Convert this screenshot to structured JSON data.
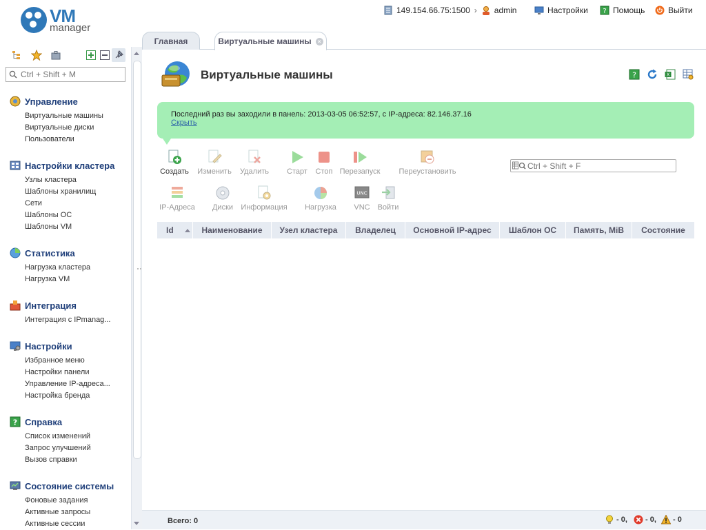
{
  "app": {
    "logo_main": "VM",
    "logo_sub": "manager"
  },
  "topbar": {
    "server": "149.154.66.75:1500",
    "user": "admin",
    "settings": "Настройки",
    "help": "Помощь",
    "logout": "Выйти"
  },
  "sidebar": {
    "search_placeholder": "Ctrl + Shift + M",
    "groups": [
      {
        "title": "Управление",
        "items": [
          "Виртуальные машины",
          "Виртуальные диски",
          "Пользователи"
        ]
      },
      {
        "title": "Настройки кластера",
        "items": [
          "Узлы кластера",
          "Шаблоны хранилищ",
          "Сети",
          "Шаблоны ОС",
          "Шаблоны VM"
        ]
      },
      {
        "title": "Статистика",
        "items": [
          "Нагрузка кластера",
          "Нагрузка VM"
        ]
      },
      {
        "title": "Интеграция",
        "items": [
          "Интеграция с IPmanag..."
        ]
      },
      {
        "title": "Настройки",
        "items": [
          "Избранное меню",
          "Настройки панели",
          "Управление IP-адреса...",
          "Настройка бренда"
        ]
      },
      {
        "title": "Справка",
        "items": [
          "Список изменений",
          "Запрос улучшений",
          "Вызов справки"
        ]
      },
      {
        "title": "Состояние системы",
        "items": [
          "Фоновые задания",
          "Активные запросы",
          "Активные сессии"
        ]
      }
    ]
  },
  "tabs": [
    {
      "label": "Главная"
    },
    {
      "label": "Виртуальные машины"
    }
  ],
  "page": {
    "title": "Виртуальные машины"
  },
  "notice": {
    "text": "Последний раз вы заходили в панель: 2013-03-05 06:52:57, с IP-адреса: 82.146.37.16",
    "hide": "Скрыть"
  },
  "toolbar": {
    "create": "Создать",
    "edit": "Изменить",
    "delete": "Удалить",
    "start": "Старт",
    "stop": "Стоп",
    "restart": "Перезапуск",
    "reinstall": "Переустановить",
    "ip": "IP-Адреса",
    "disks": "Диски",
    "info": "Информация",
    "load": "Нагрузка",
    "vnc": "VNC",
    "login": "Войти",
    "vnc_badge": "UNC"
  },
  "table": {
    "search_placeholder": "Ctrl + Shift + F",
    "columns": [
      "Id",
      "Наименование",
      "Узел кластера",
      "Владелец",
      "Основной IP-адрес",
      "Шаблон ОС",
      "Память, MiB",
      "Состояние"
    ]
  },
  "footer": {
    "total": "Всего: 0",
    "info_count": "- 0,",
    "error_count": "- 0,",
    "warn_count": "- 0"
  },
  "colors": {
    "accent": "#2f78b8",
    "notice_bg": "#a4eeb5",
    "group_title": "#1f3f7a"
  }
}
